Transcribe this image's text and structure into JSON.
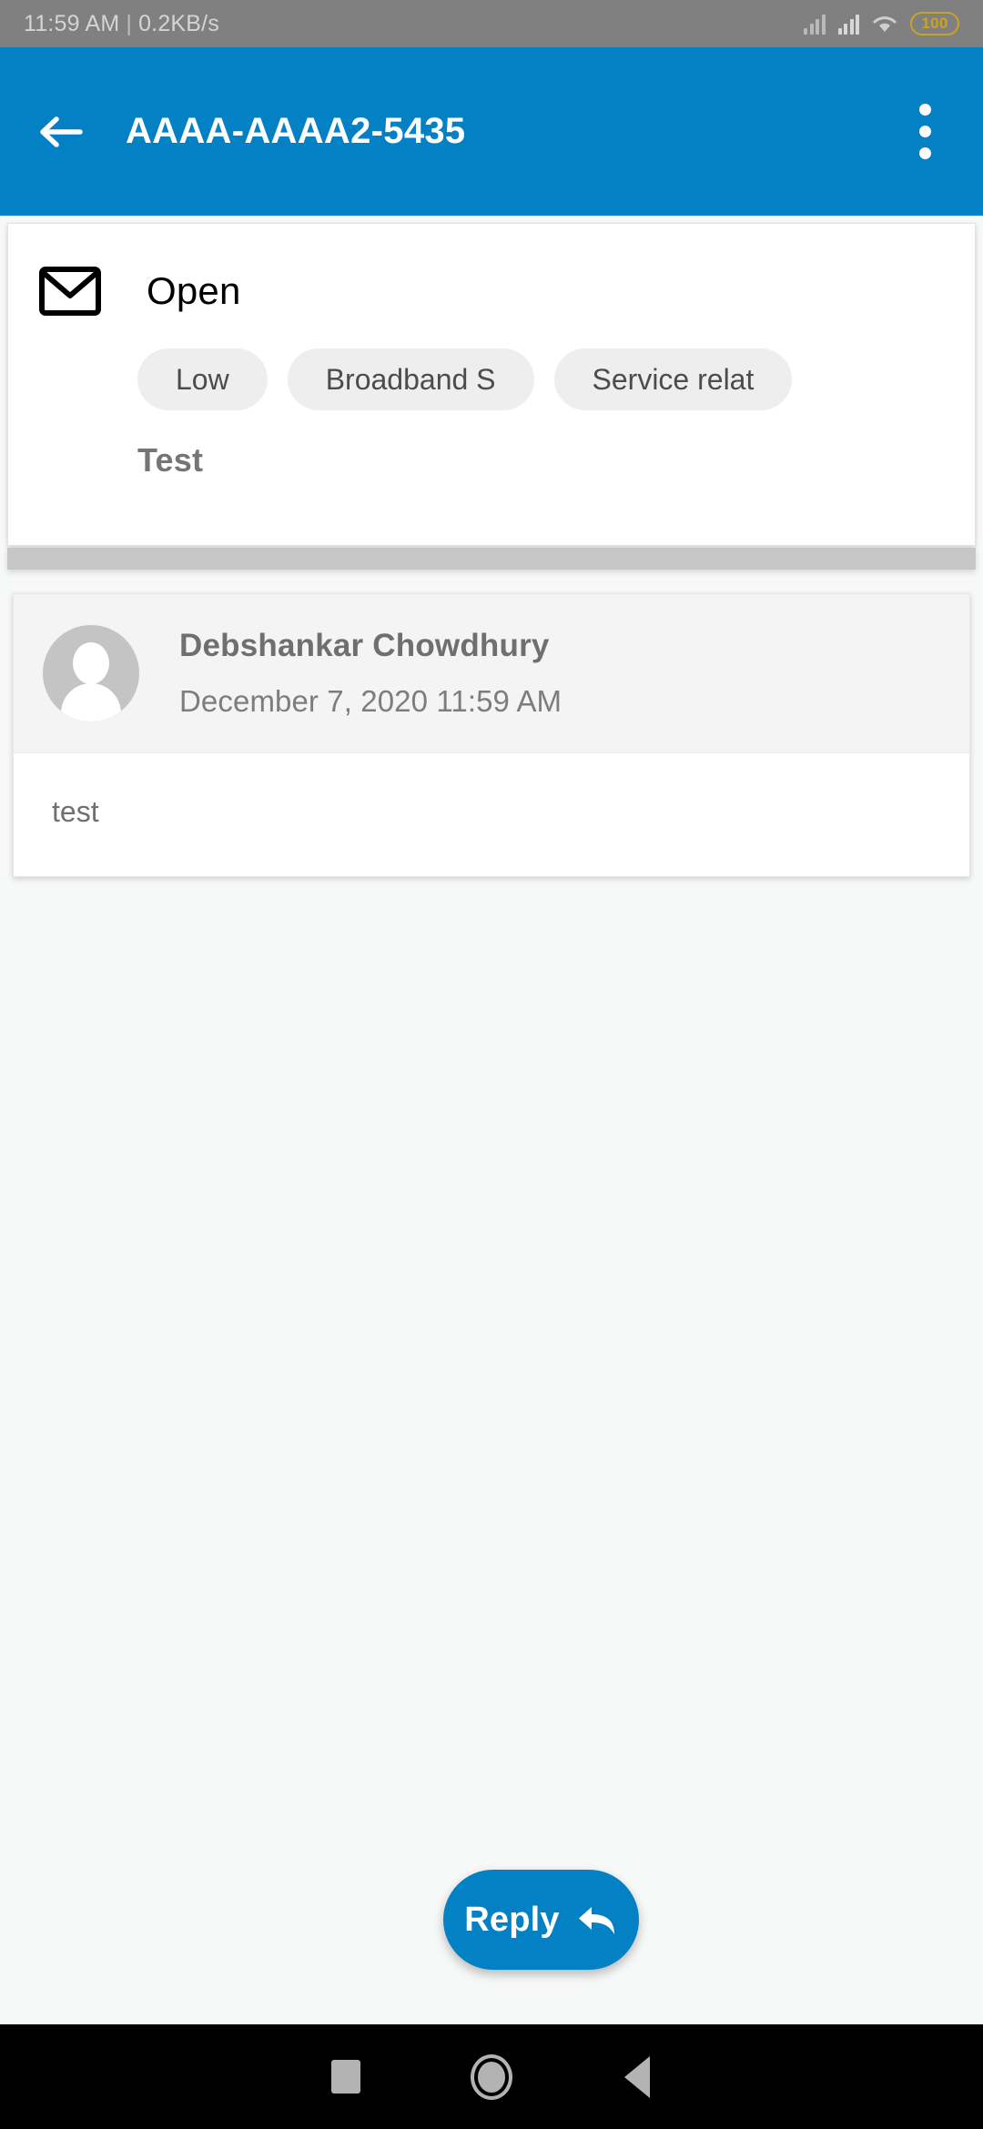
{
  "status_bar": {
    "time": "11:59 AM",
    "separator": "|",
    "network_speed": "0.2KB/s",
    "battery_level": "100",
    "icons": [
      "signal-bars-icon",
      "signal-bars-icon",
      "wifi-icon",
      "battery-icon"
    ]
  },
  "app_bar": {
    "back_icon": "back-arrow-icon",
    "title": "AAAA-AAAA2-5435",
    "overflow_icon": "overflow-menu-icon",
    "background_color": "#0481c4"
  },
  "ticket": {
    "status_icon": "mail-envelope-icon",
    "status": "Open",
    "chips": [
      {
        "label": "Low"
      },
      {
        "label": "Broadband S"
      },
      {
        "label": "Service relat"
      }
    ],
    "subject": "Test"
  },
  "message": {
    "avatar_icon": "avatar-placeholder-icon",
    "sender": "Debshankar Chowdhury",
    "timestamp": "December 7, 2020 11:59 AM",
    "body": "test"
  },
  "reply_button": {
    "label": "Reply",
    "icon": "reply-arrow-icon",
    "color": "#0481c4"
  },
  "nav_bar": {
    "recents_icon": "square-recents-icon",
    "home_icon": "circle-home-icon",
    "back_icon": "triangle-back-icon"
  }
}
